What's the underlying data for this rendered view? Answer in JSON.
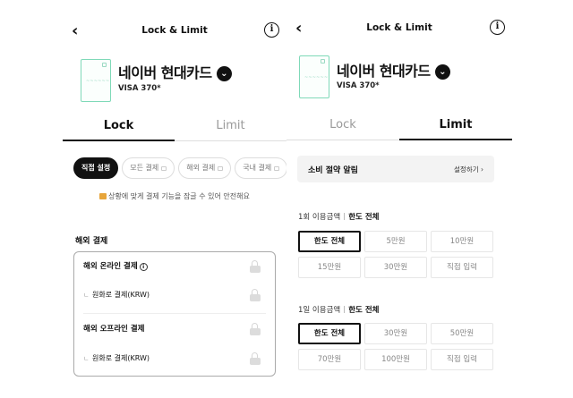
{
  "left": {
    "title": "Lock & Limit",
    "back": "‹",
    "info": "i",
    "card": {
      "name": "네이버 현대카드",
      "number": "VISA   370*",
      "chevron": "⌄"
    },
    "tabs": [
      {
        "label": "Lock"
      },
      {
        "label": "Limit"
      }
    ],
    "chips": [
      {
        "label": "직접 설정"
      },
      {
        "label": "모든 결제"
      },
      {
        "label": "해외 결제"
      },
      {
        "label": "국내 결제"
      }
    ],
    "notice": "상황에 맞게 결제 기능을 잠글 수 있어 안전해요",
    "section": "해외 결제",
    "rows": [
      {
        "label": "해외 온라인 결제",
        "has_info": true
      },
      {
        "label": "원화로 결제(KRW)"
      },
      {
        "label": "해외 오프라인 결제"
      },
      {
        "label": "원화로 결제(KRW)"
      }
    ]
  },
  "right": {
    "title": "Lock & Limit",
    "back": "‹",
    "info": "i",
    "card": {
      "name": "네이버 현대카드",
      "number": "VISA   370*",
      "chevron": "⌄"
    },
    "tabs": [
      {
        "label": "Lock"
      },
      {
        "label": "Limit"
      }
    ],
    "alert": {
      "label": "소비 절약 알림",
      "action": "설정하기 ›"
    },
    "per_use": {
      "label": "1회 이용금액",
      "value": "한도 전체",
      "options": [
        "한도 전체",
        "5만원",
        "10만원",
        "15만원",
        "30만원",
        "직접 입력"
      ]
    },
    "per_day": {
      "label": "1일 이용금액",
      "value": "한도 전체",
      "options": [
        "한도 전체",
        "30만원",
        "50만원",
        "70만원",
        "100만원",
        "직접 입력"
      ]
    }
  }
}
